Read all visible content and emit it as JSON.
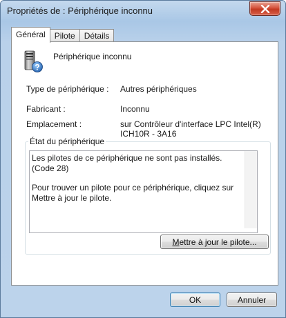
{
  "window": {
    "title": "Propriétés de : Périphérique inconnu"
  },
  "tabs": [
    {
      "label": "Général",
      "active": true
    },
    {
      "label": "Pilote",
      "active": false
    },
    {
      "label": "Détails",
      "active": false
    }
  ],
  "device": {
    "name": "Périphérique inconnu",
    "icon": "unknown-device-icon"
  },
  "properties": [
    {
      "label": "Type de périphérique :",
      "value": "Autres périphériques"
    },
    {
      "label": "Fabricant :",
      "value": "Inconnu"
    },
    {
      "label": "Emplacement :",
      "value": "sur Contrôleur d'interface LPC Intel(R) ICH10R - 3A16"
    }
  ],
  "status": {
    "legend": "État du périphérique",
    "line1": "Les pilotes de ce périphérique ne sont pas installés. (Code 28)",
    "line2": "Pour trouver un pilote pour ce périphérique, cliquez sur Mettre à jour le pilote."
  },
  "buttons": {
    "update_driver_prefix": "M",
    "update_driver_rest": "ettre à jour le pilote...",
    "ok": "OK",
    "cancel": "Annuler"
  },
  "colors": {
    "titlebar": "#a9c7e6",
    "close": "#c23a22",
    "default_button_border": "#3c7fb1"
  }
}
